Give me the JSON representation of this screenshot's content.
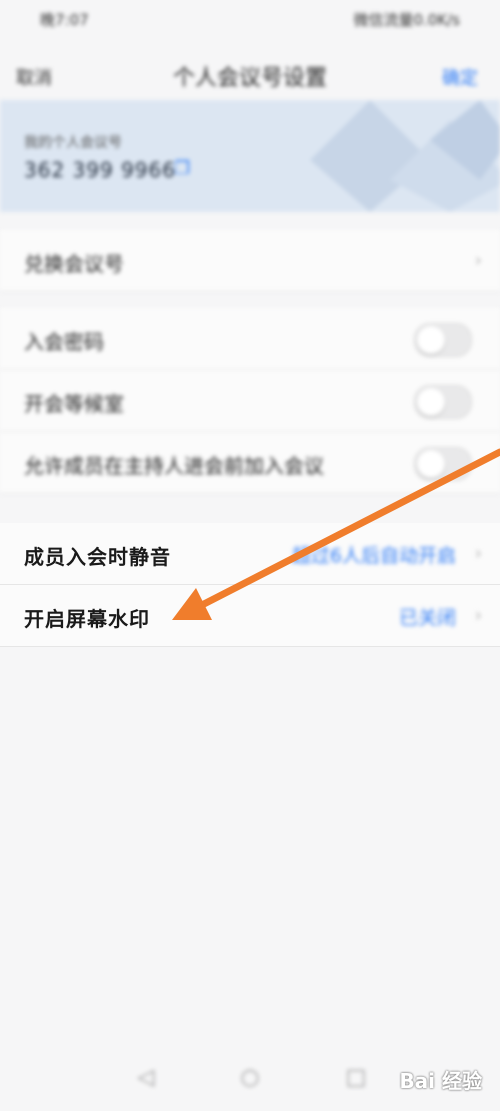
{
  "status": {
    "time": "晚7:07",
    "right": "微信流量0.0K/s"
  },
  "nav": {
    "back": "取消",
    "title": "个人会议号设置",
    "done": "确定"
  },
  "card": {
    "subtitle": "我的个人会议号",
    "number": "362 399 9966",
    "copy_icon": "copy-icon"
  },
  "section1": {
    "rows": [
      {
        "label": "兑换会议号"
      }
    ]
  },
  "section2": {
    "rows": [
      {
        "label": "入会密码"
      },
      {
        "label": "开会等候室"
      },
      {
        "label": "允许成员在主持人进会前加入会议"
      }
    ]
  },
  "section3": {
    "rows": [
      {
        "label": "成员入会时静音",
        "value": "超过6人后自动开启"
      },
      {
        "label": "开启屏幕水印",
        "value": "已关闭"
      }
    ]
  },
  "annotation": {
    "type": "arrow",
    "color": "#f07d2c"
  },
  "watermark": {
    "text": "Bai 经验"
  },
  "colors": {
    "accent": "#2f7cf6",
    "arrow": "#f07d2c"
  }
}
